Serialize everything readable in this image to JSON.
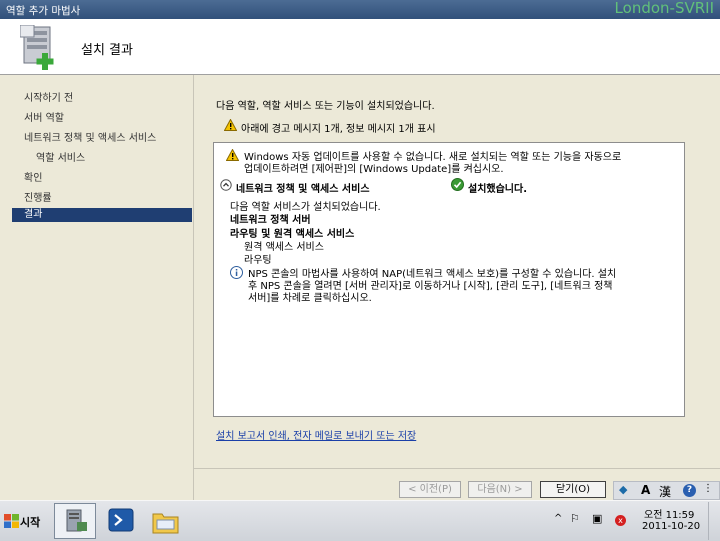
{
  "window": {
    "title": "역할 추가 마법사",
    "server_name": "London-SVRII"
  },
  "header": {
    "title": "설치 결과"
  },
  "nav": {
    "items": [
      "시작하기 전",
      "서버 역할",
      "네트워크 정책 및 액세스 서비스",
      "역할 서비스",
      "확인",
      "진행률",
      "결과"
    ],
    "active_index": 6
  },
  "main": {
    "intro": "다음 역할, 역할 서비스 또는 기능이 설치되었습니다.",
    "warning_summary": "아래에 경고 메시지 1개, 정보 메시지 1개 표시",
    "result": {
      "warning_line1": "Windows 자동 업데이트를 사용할 수 없습니다. 새로 설치되는 역할 또는 기능을 자동으로",
      "warning_line2": "업데이트하려면 [제어판]의 [Windows Update]를 켜십시오.",
      "role_header": "네트워크 정책 및 액세스 서비스",
      "status": "설치했습니다.",
      "installed_intro": "다음 역할 서비스가 설치되었습니다.",
      "service1": "네트워크 정책 서버",
      "service2": "라우팅 및 원격 액세스 서비스",
      "sub1": "원격 액세스 서비스",
      "sub2": "라우팅",
      "info_line1": "NPS 콘솔의 마법사를 사용하여 NAP(네트워크 액세스 보호)를 구성할 수 있습니다. 설치",
      "info_line2": "후 NPS 콘솔을 열려면 [서버 관리자]로 이동하거나 [시작], [관리 도구], [네트워크 정책",
      "info_line3": "서버]를 차례로 클릭하십시오."
    },
    "link": "설치 보고서 인쇄, 전자 메일로 보내기 또는 저장"
  },
  "buttons": {
    "prev": "< 이전(P)",
    "next": "다음(N) >",
    "close": "닫기(O)",
    "cancel": "취소"
  },
  "taskbar": {
    "start": "시작",
    "time": "오전 11:59",
    "date": "2011-10-20",
    "ime_char": "A",
    "ime_hanja": "漢"
  },
  "colors": {
    "nav_active": "#1f3e72",
    "link": "#1a3fa8",
    "success_green": "#3a9a34",
    "warning_yellow": "#f4c300"
  }
}
